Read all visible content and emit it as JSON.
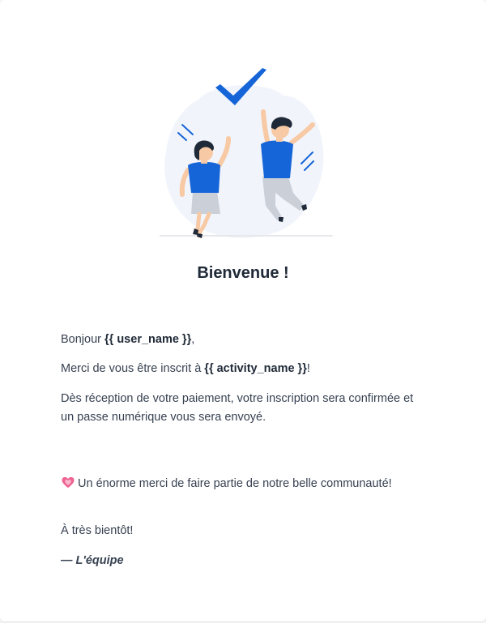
{
  "email": {
    "title": "Bienvenue !",
    "greeting": {
      "prefix": "Bonjour ",
      "user_name_placeholder": "{{ user_name }}",
      "suffix": ","
    },
    "registration": {
      "prefix": "Merci de vous être inscrit à ",
      "activity_placeholder": "{{ activity_name }}",
      "suffix": "!"
    },
    "payment_note": "Dès réception de votre paiement, votre inscription sera confirmée et un passe numérique vous sera envoyé.",
    "thanks": {
      "emoji": "💖",
      "text": "Un énorme merci de faire partie de notre belle communauté!"
    },
    "closing": "À très bientôt!",
    "signature": "— L'équipe"
  },
  "colors": {
    "accent": "#1565d8",
    "title": "#1f2937",
    "body_text": "#374151",
    "background": "#f3f4f6",
    "card": "#ffffff"
  },
  "icons": {
    "illustration": "celebrating-people-with-checkmark",
    "heart": "sparkling-heart-icon"
  }
}
